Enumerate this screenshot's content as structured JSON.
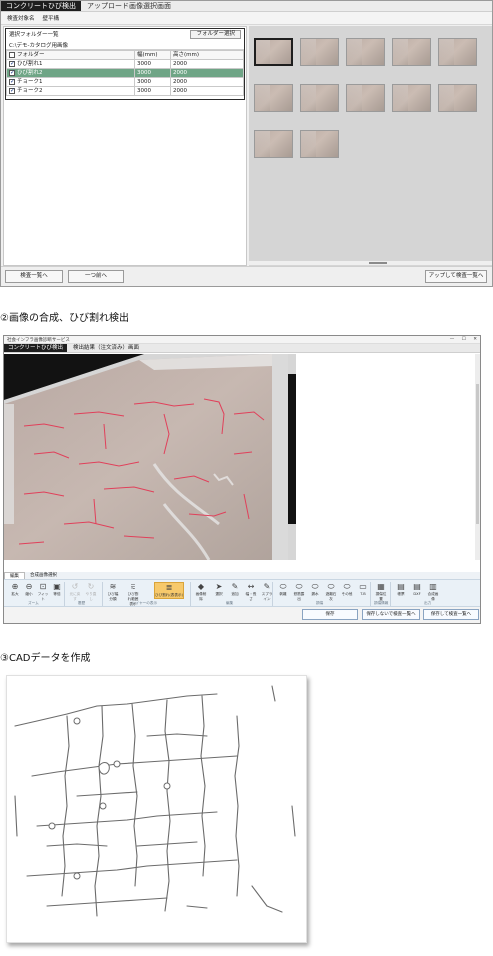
{
  "panel1": {
    "app_tab": "コンクリートひび検出",
    "screen_title": "アップロード画像選択画面",
    "target_label": "検査対象名",
    "target_value": "壁平構",
    "folder_list_title": "選択フォルダー一覧",
    "folder_select_button": "フォルダー選択",
    "folder_path": "C:\\デモ-カタログ用画像",
    "columns": [
      "フォルダー",
      "幅(mm)",
      "高さ(mm)"
    ],
    "rows": [
      {
        "name": "ひび割れ1",
        "width": "3000",
        "height": "2000",
        "checked": true,
        "selected": false
      },
      {
        "name": "ひび割れ2",
        "width": "3000",
        "height": "2000",
        "checked": true,
        "selected": true
      },
      {
        "name": "チョーク1",
        "width": "3000",
        "height": "2000",
        "checked": true,
        "selected": false
      },
      {
        "name": "チョーク2",
        "width": "3000",
        "height": "2000",
        "checked": true,
        "selected": false
      }
    ],
    "thumbnail_count": 12,
    "buttons": {
      "inspection_list": "検査一覧へ",
      "back": "一つ前へ",
      "upload_to_list": "アップして検査一覧へ"
    },
    "colors": {
      "selected_row": "#6fa586",
      "title_bar": "#1e1e1e"
    }
  },
  "heading2": "②画像の合成、ひび割れ検出",
  "panel2": {
    "window_title": "社会インフラ画像診断サービス",
    "app_tab": "コンクリートひび検出",
    "screen_title": "検出結果（注文済み）画面",
    "ribbon_tabs": [
      "編集",
      "合成画像選択"
    ],
    "ribbon_items": [
      {
        "label": "拡大",
        "icon": "zoom-in-icon",
        "glyph": "⊕",
        "enabled": true
      },
      {
        "label": "縮小",
        "icon": "zoom-out-icon",
        "glyph": "⊖",
        "enabled": true
      },
      {
        "label": "フィット",
        "icon": "fit-icon",
        "glyph": "⊡",
        "enabled": true
      },
      {
        "label": "等倍",
        "icon": "actual-size-icon",
        "glyph": "▣",
        "enabled": true
      },
      {
        "label": "元に戻す",
        "icon": "undo-icon",
        "glyph": "↺",
        "enabled": false
      },
      {
        "label": "やり直し",
        "icon": "redo-icon",
        "glyph": "↻",
        "enabled": false
      },
      {
        "label": "ひび幅分類",
        "icon": "crack-width-icon",
        "glyph": "≋",
        "enabled": true
      },
      {
        "label": "ひび割れ範囲表示",
        "icon": "crack-range-icon",
        "glyph": "⩳",
        "enabled": true
      },
      {
        "label": "ひび割れ(表表示)",
        "icon": "crack-table-icon",
        "glyph": "≣",
        "enabled": true,
        "highlight": true
      },
      {
        "label": "画像削除",
        "icon": "eraser-icon",
        "glyph": "◆",
        "enabled": true
      },
      {
        "label": "選択",
        "icon": "select-icon",
        "glyph": "➤",
        "enabled": true
      },
      {
        "label": "追加",
        "icon": "pencil-icon",
        "glyph": "✎",
        "enabled": true
      },
      {
        "label": "幅・長さ",
        "icon": "measure-icon",
        "glyph": "↔",
        "enabled": true
      },
      {
        "label": "スプライン",
        "icon": "spline-icon",
        "glyph": "✎",
        "enabled": true
      },
      {
        "label": "剥離",
        "icon": "peeling-icon",
        "glyph": "⬭",
        "enabled": true
      },
      {
        "label": "鉄筋露出",
        "icon": "rebar-icon",
        "glyph": "⬭",
        "enabled": true
      },
      {
        "label": "漏水",
        "icon": "leak-icon",
        "glyph": "⬭",
        "enabled": true
      },
      {
        "label": "遊離石灰",
        "icon": "efflorescence-icon",
        "glyph": "⬭",
        "enabled": true
      },
      {
        "label": "その他",
        "icon": "other-icon",
        "glyph": "⬭",
        "enabled": true
      },
      {
        "label": "T.B",
        "icon": "textbox-icon",
        "glyph": "▭",
        "enabled": true
      },
      {
        "label": "損傷位置",
        "icon": "damage-position-icon",
        "glyph": "▦",
        "enabled": true
      },
      {
        "label": "帳票",
        "icon": "report-icon",
        "glyph": "▤",
        "enabled": true
      },
      {
        "label": "DXF",
        "icon": "dxf-icon",
        "glyph": "▤",
        "enabled": true
      },
      {
        "label": "合成画像",
        "icon": "composite-image-icon",
        "glyph": "▥",
        "enabled": true
      }
    ],
    "ribbon_groups": [
      "ズーム",
      "履歴",
      "レイヤーの表示",
      "編集",
      "損傷",
      "損傷情報",
      "出力"
    ],
    "buttons": {
      "save": "保存",
      "no_save_to_list": "保存しないで検査一覧へ",
      "save_to_list": "保存して検査一覧へ"
    },
    "colors": {
      "crack_line": "#e0405a",
      "highlight": "#f7c96b"
    }
  },
  "heading3": "③CADデータを作成"
}
